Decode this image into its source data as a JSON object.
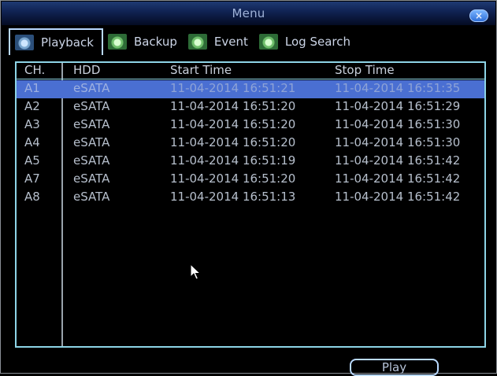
{
  "window": {
    "title": "Menu"
  },
  "tabs": [
    {
      "label": "Playback",
      "active": true
    },
    {
      "label": "Backup",
      "active": false
    },
    {
      "label": "Event",
      "active": false
    },
    {
      "label": "Log Search",
      "active": false
    }
  ],
  "table": {
    "headers": {
      "ch": "CH.",
      "hdd": "HDD",
      "start": "Start Time",
      "stop": "Stop Time"
    },
    "rows": [
      {
        "ch": "A1",
        "hdd": "eSATA",
        "start": "11-04-2014 16:51:21",
        "stop": "11-04-2014 16:51:35",
        "selected": true
      },
      {
        "ch": "A2",
        "hdd": "eSATA",
        "start": "11-04-2014 16:51:20",
        "stop": "11-04-2014 16:51:29"
      },
      {
        "ch": "A3",
        "hdd": "eSATA",
        "start": "11-04-2014 16:51:20",
        "stop": "11-04-2014 16:51:30"
      },
      {
        "ch": "A4",
        "hdd": "eSATA",
        "start": "11-04-2014 16:51:20",
        "stop": "11-04-2014 16:51:30"
      },
      {
        "ch": "A5",
        "hdd": "eSATA",
        "start": "11-04-2014 16:51:19",
        "stop": "11-04-2014 16:51:42"
      },
      {
        "ch": "A7",
        "hdd": "eSATA",
        "start": "11-04-2014 16:51:20",
        "stop": "11-04-2014 16:51:42"
      },
      {
        "ch": "A8",
        "hdd": "eSATA",
        "start": "11-04-2014 16:51:13",
        "stop": "11-04-2014 16:51:42"
      }
    ]
  },
  "buttons": {
    "play": "Play",
    "close": "×"
  },
  "icons": {
    "tab_icon": "camera-icon",
    "close": "close-icon",
    "cursor": "mouse-pointer-icon"
  },
  "colors": {
    "selected_row": "#4a6fd2",
    "panel_border": "#8dd4e6",
    "title_bar": "#0f2150"
  }
}
